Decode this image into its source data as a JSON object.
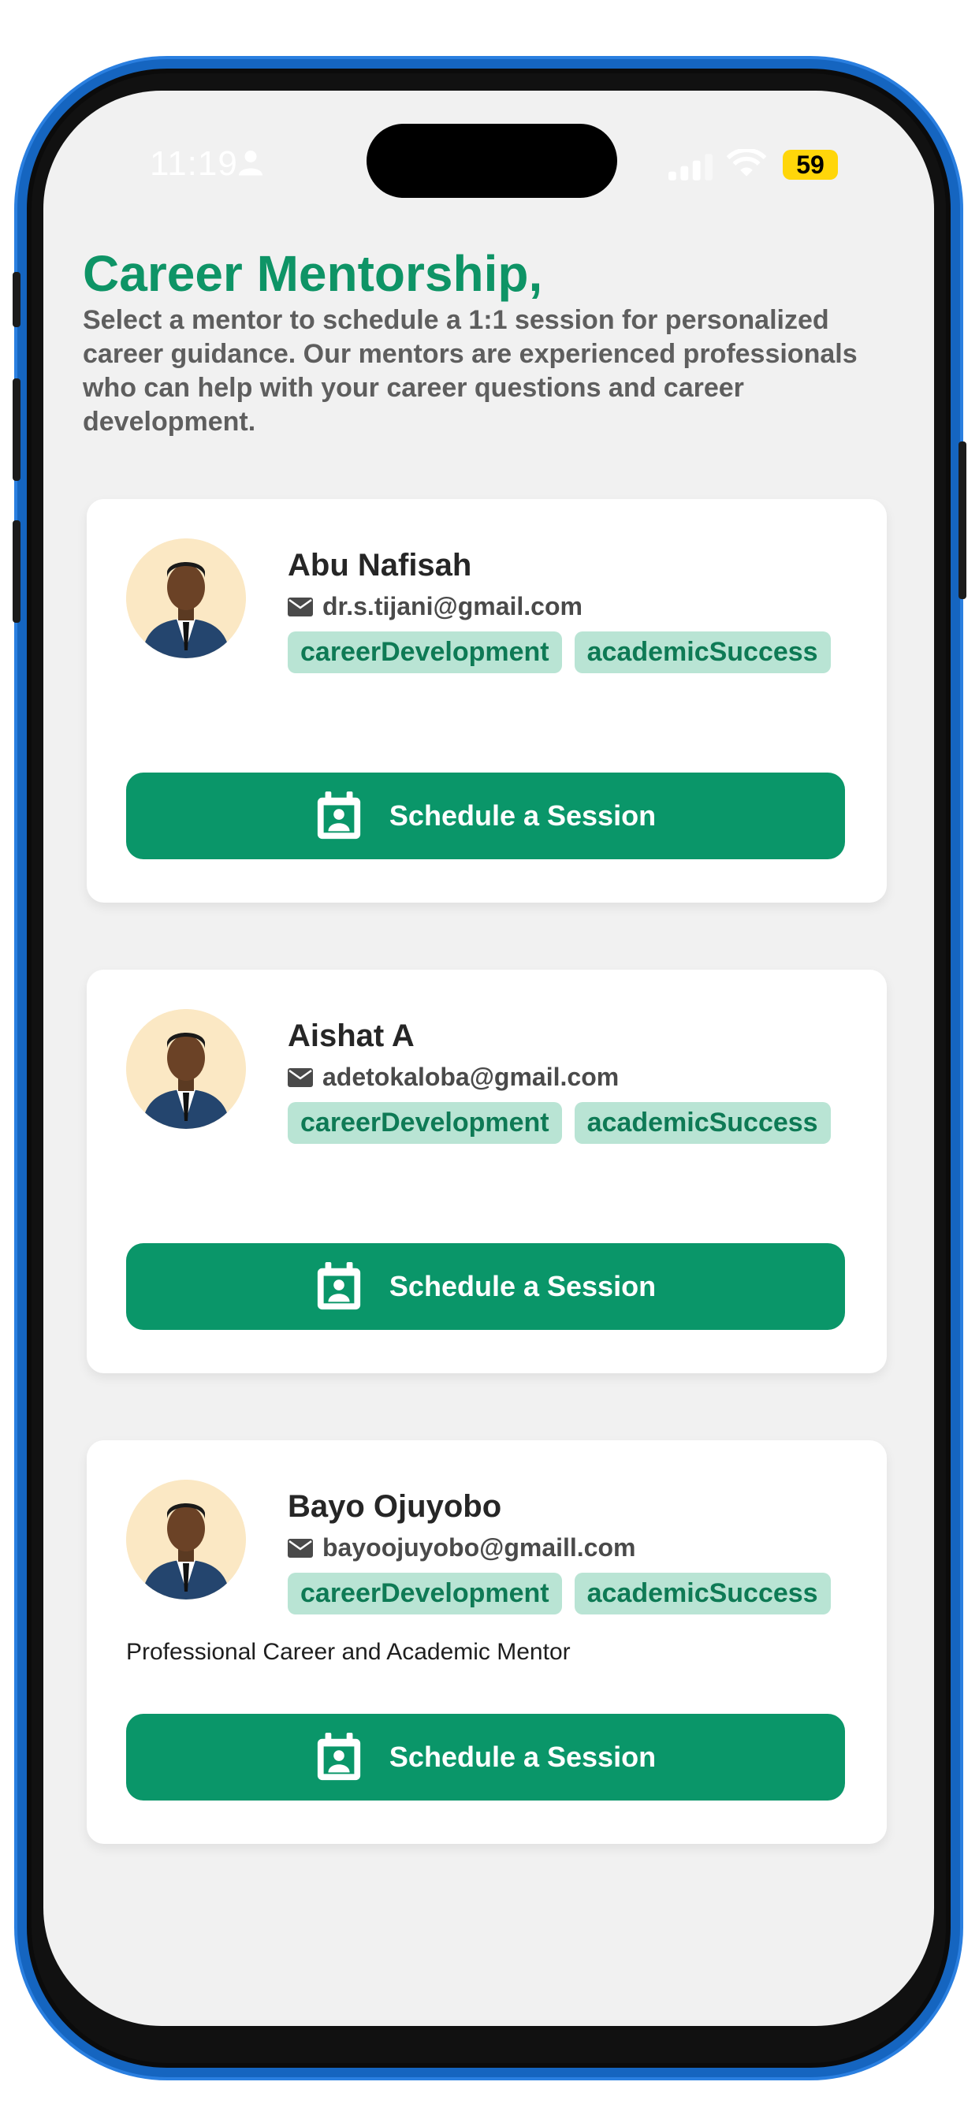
{
  "status_bar": {
    "time": "11:19",
    "battery": "59",
    "icons": [
      "person-icon",
      "signal-icon",
      "wifi-icon"
    ],
    "battery_color": "#ffd60a"
  },
  "header": {
    "title": "Career Mentorship,",
    "subtitle": "Select a mentor to schedule a 1:1 session for personalized career guidance. Our mentors are experienced professionals who can help with your career questions and career development."
  },
  "mentors": [
    {
      "name": "Abu Nafisah",
      "email": "dr.s.tijani@gmail.com",
      "tags": [
        "careerDevelopment",
        "academicSuccess"
      ],
      "description": "",
      "button_label": "Schedule a Session"
    },
    {
      "name": "Aishat A",
      "email": "adetokaloba@gmail.com",
      "tags": [
        "careerDevelopment",
        "academicSuccess"
      ],
      "description": "",
      "button_label": "Schedule a Session"
    },
    {
      "name": "Bayo Ojuyobo",
      "email": "bayoojuyobo@gmaill.com",
      "tags": [
        "careerDevelopment",
        "academicSuccess"
      ],
      "description": "Professional Career and Academic Mentor",
      "button_label": "Schedule a Session"
    }
  ],
  "colors": {
    "accent": "#0e9466",
    "button": "#0a9669",
    "tag_bg": "#b9e4d4",
    "tag_text": "#0e7a55",
    "screen_bg": "#f1f1f1"
  }
}
